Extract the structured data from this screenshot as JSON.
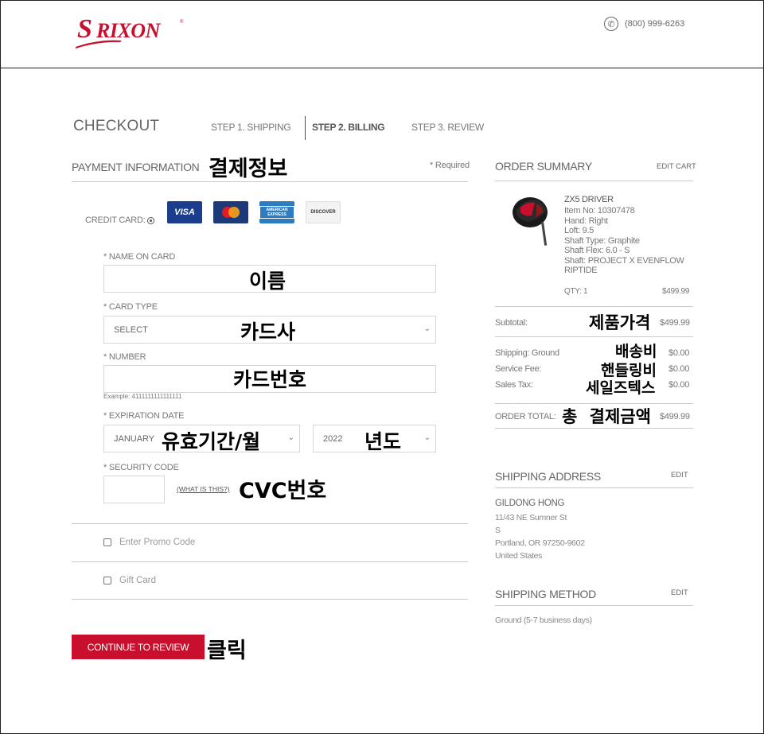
{
  "header": {
    "brand": "SRIXON",
    "phone": "(800) 999-6263"
  },
  "checkout": {
    "title": "CHECKOUT",
    "steps": [
      "STEP 1. SHIPPING",
      "STEP 2. BILLING",
      "STEP 3. REVIEW"
    ]
  },
  "payment": {
    "title": "PAYMENT INFORMATION",
    "title_note": "결제정보",
    "required": "* Required",
    "credit_card_label": "CREDIT CARD:",
    "cards": [
      "VISA",
      "MasterCard",
      "AMERICAN EXPRESS",
      "DISCOVER"
    ],
    "name_label": "* NAME ON CARD",
    "name_note": "이름",
    "card_type_label": "* CARD TYPE",
    "card_type_value": "SELECT",
    "card_type_note": "카드사",
    "number_label": "* NUMBER",
    "number_note": "카드번호",
    "number_example": "Example: 4111111111111111",
    "expiration_label": "* EXPIRATION DATE",
    "exp_month": "JANUARY",
    "exp_month_note": "유효기간/월",
    "exp_year": "2022",
    "exp_year_note": "년도",
    "security_label": "* SECURITY CODE",
    "what_is_this": "(WHAT IS THIS?)",
    "security_note": "CVC번호",
    "promo_label": "Enter Promo Code",
    "gift_label": "Gift Card",
    "continue_label": "CONTINUE TO REVIEW",
    "continue_note": "클릭"
  },
  "summary": {
    "title": "ORDER SUMMARY",
    "edit_cart": "EDIT CART",
    "product": {
      "name": "ZX5 DRIVER",
      "details": [
        "Item No: 10307478",
        "Hand: Right",
        "Loft: 9.5",
        "Shaft Type: Graphite",
        "Shaft Flex: 6.0 - S",
        "Shaft: PROJECT X EVENFLOW",
        "RIPTIDE"
      ],
      "qty": "QTY: 1",
      "price": "$499.99"
    },
    "subtotal_label": "Subtotal:",
    "subtotal_note": "제품가격",
    "subtotal_value": "$499.99",
    "shipping_label": "Shipping: Ground",
    "shipping_note": "배송비",
    "shipping_value": "$0.00",
    "service_label": "Service Fee:",
    "service_note": "핸들링비",
    "service_value": "$0.00",
    "tax_label": "Sales Tax:",
    "tax_note": "세일즈텍스",
    "tax_value": "$0.00",
    "total_label": "ORDER TOTAL:",
    "total_note": "총 결제금액",
    "total_value": "$499.99"
  },
  "shipping_address": {
    "title": "SHIPPING ADDRESS",
    "edit": "EDIT",
    "name": "GILDONG HONG",
    "lines": [
      "11/43 NE Sumner St",
      "S",
      "Portland, OR 97250-9602",
      "United States"
    ]
  },
  "shipping_method": {
    "title": "SHIPPING METHOD",
    "edit": "EDIT",
    "value": "Ground (5-7 business days)"
  },
  "colors": {
    "brand_red": "#c8102e"
  }
}
